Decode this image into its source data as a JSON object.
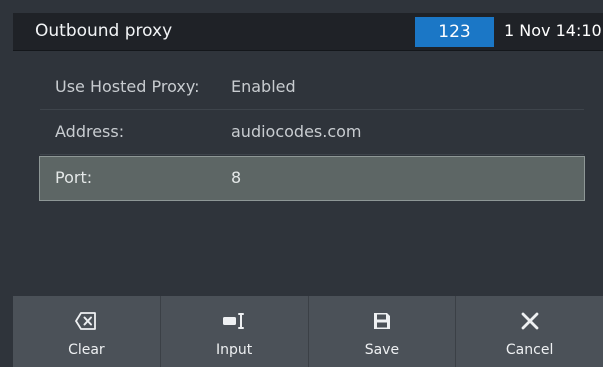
{
  "header": {
    "title": "Outbound proxy",
    "line_badge": "123",
    "datetime": "1 Nov 14:10"
  },
  "settings": {
    "rows": [
      {
        "label": "Use Hosted Proxy:",
        "value": "Enabled"
      },
      {
        "label": "Address:",
        "value": "audiocodes.com"
      },
      {
        "label": "Port:",
        "value": "8"
      }
    ],
    "selected_row": "Port:"
  },
  "softkeys": [
    {
      "label": "Clear",
      "icon": "backspace-icon"
    },
    {
      "label": "Input",
      "icon": "input-mode-icon"
    },
    {
      "label": "Save",
      "icon": "floppy-disk-icon"
    },
    {
      "label": "Cancel",
      "icon": "close-icon"
    }
  ],
  "colors": {
    "accent": "#1b77c6",
    "background": "#2f343b",
    "header": "#1f2227",
    "selected_row": "#5d6665",
    "softkey_bar": "#4b5158"
  }
}
